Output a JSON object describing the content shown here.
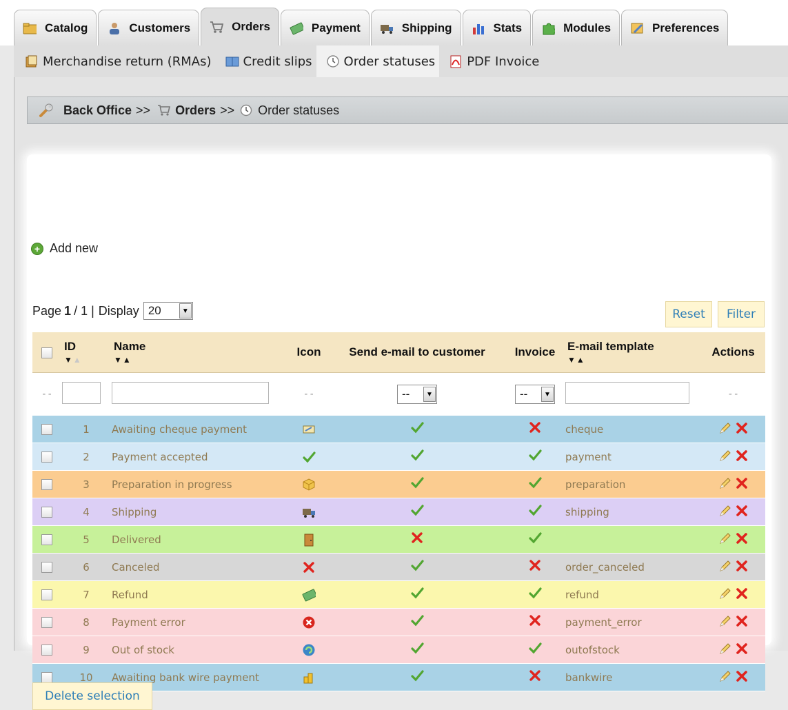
{
  "tabs": [
    {
      "label": "Catalog",
      "icon": "folder-icon"
    },
    {
      "label": "Customers",
      "icon": "customers-icon"
    },
    {
      "label": "Orders",
      "icon": "cart-icon",
      "active": true
    },
    {
      "label": "Payment",
      "icon": "banknote-icon"
    },
    {
      "label": "Shipping",
      "icon": "truck-icon"
    },
    {
      "label": "Stats",
      "icon": "bar-chart-icon"
    },
    {
      "label": "Modules",
      "icon": "puzzle-icon"
    },
    {
      "label": "Preferences",
      "icon": "preferences-icon"
    }
  ],
  "subtabs": [
    {
      "label": "Merchandise return (RMAs)",
      "icon": "return-icon"
    },
    {
      "label": "Credit slips",
      "icon": "book-icon"
    },
    {
      "label": "Order statuses",
      "icon": "clock-icon",
      "active": true
    },
    {
      "label": "PDF Invoice",
      "icon": "pdf-icon"
    }
  ],
  "breadcrumb": {
    "root": "Back Office",
    "sep": ">>",
    "section": "Orders",
    "current": "Order statuses"
  },
  "add_new": "Add new",
  "pagination": {
    "page_label": "Page",
    "current": "1",
    "sep": "/",
    "total": "1",
    "pipe": "|",
    "display_label": "Display",
    "per_page": "20"
  },
  "buttons": {
    "reset": "Reset",
    "filter": "Filter",
    "delete_selection": "Delete selection"
  },
  "columns": {
    "id": "ID",
    "name": "Name",
    "icon": "Icon",
    "send_email": "Send e-mail to customer",
    "invoice": "Invoice",
    "template": "E-mail template",
    "actions": "Actions"
  },
  "filters": {
    "placeholder_dash": "--",
    "select_value": "--"
  },
  "colors": {
    "accent_link": "#2f7fb7",
    "check": "#52a631",
    "cross": "#e0241e"
  },
  "rows": [
    {
      "id": "1",
      "name": "Awaiting cheque payment",
      "icon": "cheque-icon",
      "send_email": true,
      "invoice": false,
      "template": "cheque",
      "color": "#a9d2e6"
    },
    {
      "id": "2",
      "name": "Payment accepted",
      "icon": "check-icon",
      "send_email": true,
      "invoice": true,
      "template": "payment",
      "color": "#d4e8f6"
    },
    {
      "id": "3",
      "name": "Preparation in progress",
      "icon": "box-icon",
      "send_email": true,
      "invoice": true,
      "template": "preparation",
      "color": "#fbcc90"
    },
    {
      "id": "4",
      "name": "Shipping",
      "icon": "truck-icon",
      "send_email": true,
      "invoice": true,
      "template": "shipping",
      "color": "#dccff5"
    },
    {
      "id": "5",
      "name": "Delivered",
      "icon": "door-icon",
      "send_email": false,
      "invoice": true,
      "template": "",
      "color": "#c7f19a"
    },
    {
      "id": "6",
      "name": "Canceled",
      "icon": "cross-icon",
      "send_email": true,
      "invoice": false,
      "template": "order_canceled",
      "color": "#d7d7d7"
    },
    {
      "id": "7",
      "name": "Refund",
      "icon": "banknote-icon",
      "send_email": true,
      "invoice": true,
      "template": "refund",
      "color": "#fbf7ad"
    },
    {
      "id": "8",
      "name": "Payment error",
      "icon": "error-icon",
      "send_email": true,
      "invoice": false,
      "template": "payment_error",
      "color": "#fbd5d8"
    },
    {
      "id": "9",
      "name": "Out of stock",
      "icon": "refresh-icon",
      "send_email": true,
      "invoice": true,
      "template": "outofstock",
      "color": "#fbd5d8"
    },
    {
      "id": "10",
      "name": "Awaiting bank wire payment",
      "icon": "coins-icon",
      "send_email": true,
      "invoice": false,
      "template": "bankwire",
      "color": "#a9d2e6"
    }
  ]
}
